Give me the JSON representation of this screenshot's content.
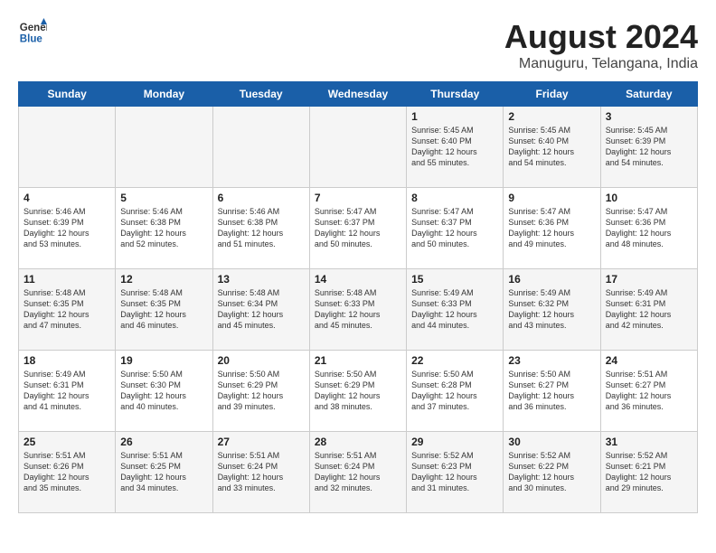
{
  "header": {
    "logo_line1": "General",
    "logo_line2": "Blue",
    "title": "August 2024",
    "subtitle": "Manuguru, Telangana, India"
  },
  "weekdays": [
    "Sunday",
    "Monday",
    "Tuesday",
    "Wednesday",
    "Thursday",
    "Friday",
    "Saturday"
  ],
  "weeks": [
    [
      {
        "day": "",
        "content": ""
      },
      {
        "day": "",
        "content": ""
      },
      {
        "day": "",
        "content": ""
      },
      {
        "day": "",
        "content": ""
      },
      {
        "day": "1",
        "content": "Sunrise: 5:45 AM\nSunset: 6:40 PM\nDaylight: 12 hours\nand 55 minutes."
      },
      {
        "day": "2",
        "content": "Sunrise: 5:45 AM\nSunset: 6:40 PM\nDaylight: 12 hours\nand 54 minutes."
      },
      {
        "day": "3",
        "content": "Sunrise: 5:45 AM\nSunset: 6:39 PM\nDaylight: 12 hours\nand 54 minutes."
      }
    ],
    [
      {
        "day": "4",
        "content": "Sunrise: 5:46 AM\nSunset: 6:39 PM\nDaylight: 12 hours\nand 53 minutes."
      },
      {
        "day": "5",
        "content": "Sunrise: 5:46 AM\nSunset: 6:38 PM\nDaylight: 12 hours\nand 52 minutes."
      },
      {
        "day": "6",
        "content": "Sunrise: 5:46 AM\nSunset: 6:38 PM\nDaylight: 12 hours\nand 51 minutes."
      },
      {
        "day": "7",
        "content": "Sunrise: 5:47 AM\nSunset: 6:37 PM\nDaylight: 12 hours\nand 50 minutes."
      },
      {
        "day": "8",
        "content": "Sunrise: 5:47 AM\nSunset: 6:37 PM\nDaylight: 12 hours\nand 50 minutes."
      },
      {
        "day": "9",
        "content": "Sunrise: 5:47 AM\nSunset: 6:36 PM\nDaylight: 12 hours\nand 49 minutes."
      },
      {
        "day": "10",
        "content": "Sunrise: 5:47 AM\nSunset: 6:36 PM\nDaylight: 12 hours\nand 48 minutes."
      }
    ],
    [
      {
        "day": "11",
        "content": "Sunrise: 5:48 AM\nSunset: 6:35 PM\nDaylight: 12 hours\nand 47 minutes."
      },
      {
        "day": "12",
        "content": "Sunrise: 5:48 AM\nSunset: 6:35 PM\nDaylight: 12 hours\nand 46 minutes."
      },
      {
        "day": "13",
        "content": "Sunrise: 5:48 AM\nSunset: 6:34 PM\nDaylight: 12 hours\nand 45 minutes."
      },
      {
        "day": "14",
        "content": "Sunrise: 5:48 AM\nSunset: 6:33 PM\nDaylight: 12 hours\nand 45 minutes."
      },
      {
        "day": "15",
        "content": "Sunrise: 5:49 AM\nSunset: 6:33 PM\nDaylight: 12 hours\nand 44 minutes."
      },
      {
        "day": "16",
        "content": "Sunrise: 5:49 AM\nSunset: 6:32 PM\nDaylight: 12 hours\nand 43 minutes."
      },
      {
        "day": "17",
        "content": "Sunrise: 5:49 AM\nSunset: 6:31 PM\nDaylight: 12 hours\nand 42 minutes."
      }
    ],
    [
      {
        "day": "18",
        "content": "Sunrise: 5:49 AM\nSunset: 6:31 PM\nDaylight: 12 hours\nand 41 minutes."
      },
      {
        "day": "19",
        "content": "Sunrise: 5:50 AM\nSunset: 6:30 PM\nDaylight: 12 hours\nand 40 minutes."
      },
      {
        "day": "20",
        "content": "Sunrise: 5:50 AM\nSunset: 6:29 PM\nDaylight: 12 hours\nand 39 minutes."
      },
      {
        "day": "21",
        "content": "Sunrise: 5:50 AM\nSunset: 6:29 PM\nDaylight: 12 hours\nand 38 minutes."
      },
      {
        "day": "22",
        "content": "Sunrise: 5:50 AM\nSunset: 6:28 PM\nDaylight: 12 hours\nand 37 minutes."
      },
      {
        "day": "23",
        "content": "Sunrise: 5:50 AM\nSunset: 6:27 PM\nDaylight: 12 hours\nand 36 minutes."
      },
      {
        "day": "24",
        "content": "Sunrise: 5:51 AM\nSunset: 6:27 PM\nDaylight: 12 hours\nand 36 minutes."
      }
    ],
    [
      {
        "day": "25",
        "content": "Sunrise: 5:51 AM\nSunset: 6:26 PM\nDaylight: 12 hours\nand 35 minutes."
      },
      {
        "day": "26",
        "content": "Sunrise: 5:51 AM\nSunset: 6:25 PM\nDaylight: 12 hours\nand 34 minutes."
      },
      {
        "day": "27",
        "content": "Sunrise: 5:51 AM\nSunset: 6:24 PM\nDaylight: 12 hours\nand 33 minutes."
      },
      {
        "day": "28",
        "content": "Sunrise: 5:51 AM\nSunset: 6:24 PM\nDaylight: 12 hours\nand 32 minutes."
      },
      {
        "day": "29",
        "content": "Sunrise: 5:52 AM\nSunset: 6:23 PM\nDaylight: 12 hours\nand 31 minutes."
      },
      {
        "day": "30",
        "content": "Sunrise: 5:52 AM\nSunset: 6:22 PM\nDaylight: 12 hours\nand 30 minutes."
      },
      {
        "day": "31",
        "content": "Sunrise: 5:52 AM\nSunset: 6:21 PM\nDaylight: 12 hours\nand 29 minutes."
      }
    ]
  ]
}
